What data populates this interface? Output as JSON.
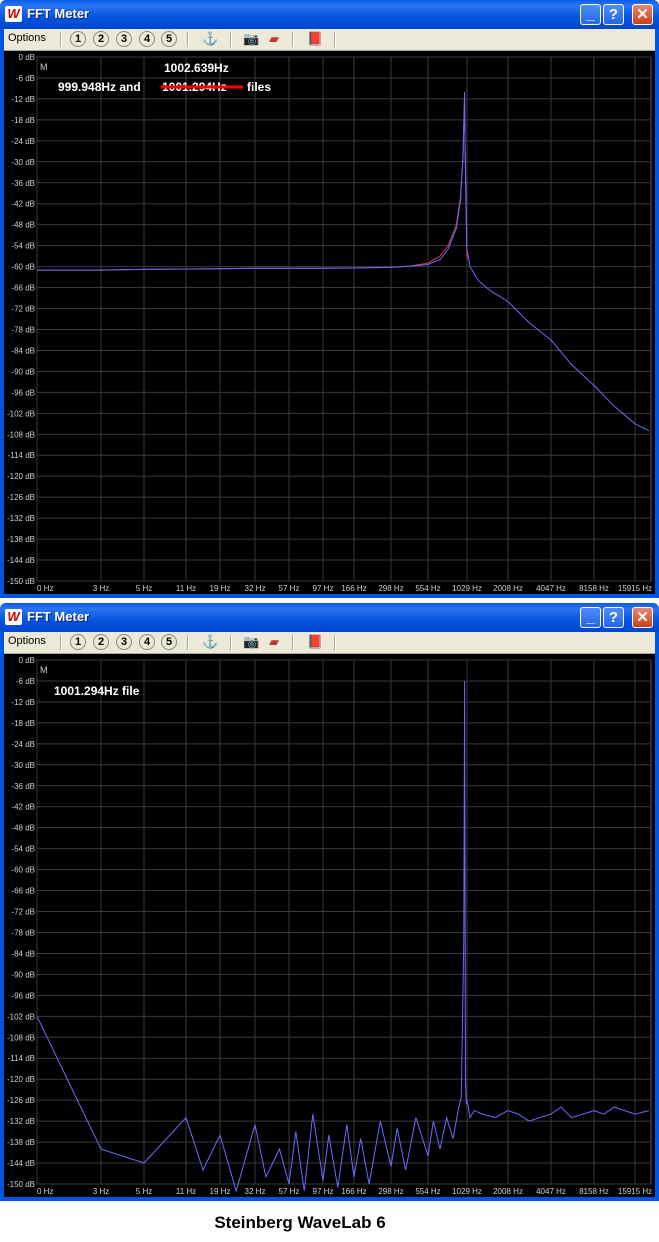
{
  "caption": "Steinberg WaveLab 6",
  "windows": [
    {
      "title": "FFT Meter",
      "menu_label": "Options",
      "preset_buttons": [
        "1",
        "2",
        "3",
        "4",
        "5"
      ],
      "mode_label": "M",
      "annotations": [
        "1002.639Hz",
        "999.948Hz and",
        "1001.294Hz",
        "files"
      ],
      "strike_color": "#ff0000"
    },
    {
      "title": "FFT Meter",
      "menu_label": "Options",
      "preset_buttons": [
        "1",
        "2",
        "3",
        "4",
        "5"
      ],
      "mode_label": "M",
      "annotations": [
        "1001.294Hz file"
      ]
    }
  ],
  "icons": [
    "wavelab-logo-icon",
    "minimize-icon",
    "help-icon",
    "close-icon",
    "marker-icon",
    "camera-icon",
    "eraser-icon",
    "book-icon"
  ],
  "chart_data": [
    {
      "type": "line",
      "y_ticks": [
        "0 dB",
        "-6 dB",
        "-12 dB",
        "-18 dB",
        "-24 dB",
        "-30 dB",
        "-36 dB",
        "-42 dB",
        "-48 dB",
        "-54 dB",
        "-60 dB",
        "-66 dB",
        "-72 dB",
        "-78 dB",
        "-84 dB",
        "-90 dB",
        "-96 dB",
        "-102 dB",
        "-108 dB",
        "-114 dB",
        "-120 dB",
        "-126 dB",
        "-132 dB",
        "-138 dB",
        "-144 dB",
        "-150 dB"
      ],
      "x_ticks": [
        "0 Hz",
        "3 Hz",
        "5 Hz",
        "11 Hz",
        "19 Hz",
        "32 Hz",
        "57 Hz",
        "97 Hz",
        "166 Hz",
        "298 Hz",
        "554 Hz",
        "1029 Hz",
        "2008 Hz",
        "4047 Hz",
        "8158 Hz",
        "15915 Hz"
      ],
      "ylim": [
        -150,
        0
      ],
      "grid": true,
      "series": [
        {
          "color": "#cc4444",
          "x": [
            0,
            3,
            5,
            11,
            19,
            32,
            57,
            97,
            166,
            298,
            420,
            554,
            700,
            800,
            900,
            950,
            980,
            1000,
            1005,
            1020,
            1029
          ],
          "y": [
            -61,
            -61,
            -60.8,
            -60.7,
            -60.6,
            -60.5,
            -60.5,
            -60.5,
            -60.4,
            -60.2,
            -59.9,
            -59,
            -57,
            -54,
            -48,
            -40,
            -28,
            -11,
            -25,
            -48,
            -58
          ]
        },
        {
          "color": "#6a6aff",
          "x": [
            0,
            3,
            5,
            11,
            19,
            32,
            57,
            97,
            166,
            298,
            420,
            554,
            700,
            800,
            900,
            950,
            980,
            1000,
            1005,
            1020,
            1029,
            1100,
            1300,
            1600,
            2008,
            3000,
            4047,
            6000,
            8158,
            12000,
            15915,
            20000
          ],
          "y": [
            -61,
            -61,
            -60.8,
            -60.7,
            -60.6,
            -60.5,
            -60.5,
            -60.5,
            -60.4,
            -60.2,
            -59.9,
            -59.4,
            -58,
            -55,
            -49,
            -41,
            -29,
            -10,
            -24,
            -46,
            -55,
            -60,
            -64,
            -67,
            -70,
            -76,
            -81,
            -88,
            -94,
            -100,
            -105,
            -107
          ]
        }
      ]
    },
    {
      "type": "line",
      "y_ticks": [
        "0 dB",
        "-6 dB",
        "-12 dB",
        "-18 dB",
        "-24 dB",
        "-30 dB",
        "-36 dB",
        "-42 dB",
        "-48 dB",
        "-54 dB",
        "-60 dB",
        "-66 dB",
        "-72 dB",
        "-78 dB",
        "-84 dB",
        "-90 dB",
        "-96 dB",
        "-102 dB",
        "-108 dB",
        "-114 dB",
        "-120 dB",
        "-126 dB",
        "-132 dB",
        "-138 dB",
        "-144 dB",
        "-150 dB"
      ],
      "x_ticks": [
        "0 Hz",
        "3 Hz",
        "5 Hz",
        "11 Hz",
        "19 Hz",
        "32 Hz",
        "57 Hz",
        "97 Hz",
        "166 Hz",
        "298 Hz",
        "554 Hz",
        "1029 Hz",
        "2008 Hz",
        "4047 Hz",
        "8158 Hz",
        "15915 Hz"
      ],
      "ylim": [
        -150,
        0
      ],
      "grid": true,
      "series": [
        {
          "color": "#6a6aff",
          "x": [
            0,
            3,
            5,
            11,
            15,
            19,
            25,
            32,
            40,
            50,
            57,
            65,
            75,
            85,
            97,
            110,
            130,
            150,
            166,
            190,
            220,
            260,
            298,
            340,
            400,
            470,
            554,
            620,
            700,
            780,
            860,
            920,
            960,
            990,
            1000,
            1005,
            1010,
            1020,
            1029,
            1060,
            1100,
            1200,
            1400,
            1700,
            2008,
            2500,
            3000,
            4047,
            5000,
            6000,
            8158,
            10000,
            12000,
            15915,
            20000
          ],
          "y": [
            -102,
            -140,
            -144,
            -131,
            -146,
            -136,
            -152,
            -133,
            -148,
            -140,
            -150,
            -135,
            -152,
            -130,
            -149,
            -136,
            -151,
            -133,
            -148,
            -137,
            -150,
            -132,
            -145,
            -134,
            -146,
            -131,
            -142,
            -132,
            -140,
            -131,
            -137,
            -129,
            -125,
            -80,
            -6,
            -60,
            -120,
            -127,
            -126,
            -128,
            -131,
            -129,
            -130,
            -131,
            -129,
            -130,
            -132,
            -130,
            -128,
            -131,
            -129,
            -130,
            -128,
            -130,
            -129
          ]
        }
      ]
    }
  ]
}
